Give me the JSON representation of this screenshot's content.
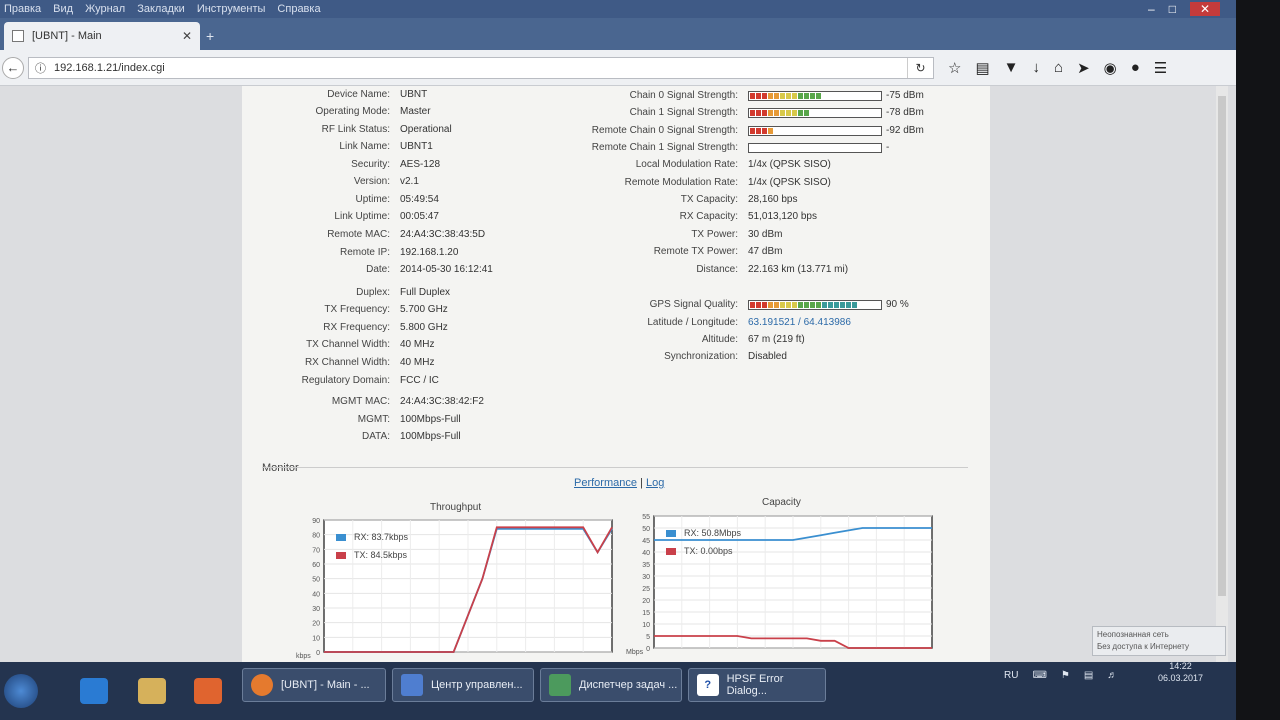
{
  "browser": {
    "menu": [
      "Вид",
      "Правка",
      "Вид",
      "Журнал",
      "Закладки",
      "Инструменты",
      "Справка"
    ],
    "tab_title": "[UBNT] - Main",
    "url": "192.168.1.21/index.cgi"
  },
  "left_fields": [
    {
      "label": "Device Name:",
      "value": "UBNT"
    },
    {
      "label": "Operating Mode:",
      "value": "Master"
    },
    {
      "label": "RF Link Status:",
      "value": "Operational"
    },
    {
      "label": "Link Name:",
      "value": "UBNT1"
    },
    {
      "label": "Security:",
      "value": "AES-128"
    },
    {
      "label": "Version:",
      "value": "v2.1"
    },
    {
      "label": "Uptime:",
      "value": "05:49:54"
    },
    {
      "label": "Link Uptime:",
      "value": "00:05:47"
    },
    {
      "label": "Remote MAC:",
      "value": "24:A4:3C:38:43:5D"
    },
    {
      "label": "Remote IP:",
      "value": "192.168.1.20"
    },
    {
      "label": "Date:",
      "value": "2014-05-30 16:12:41"
    },
    {
      "label": "Duplex:",
      "value": "Full Duplex"
    },
    {
      "label": "TX Frequency:",
      "value": "5.700 GHz"
    },
    {
      "label": "RX Frequency:",
      "value": "5.800 GHz"
    },
    {
      "label": "TX Channel Width:",
      "value": "40 MHz"
    },
    {
      "label": "RX Channel Width:",
      "value": "40 MHz"
    },
    {
      "label": "Regulatory Domain:",
      "value": "FCC / IC"
    },
    {
      "label": "MGMT MAC:",
      "value": "24:A4:3C:38:42:F2"
    },
    {
      "label": "MGMT:",
      "value": "100Mbps-Full"
    },
    {
      "label": "DATA:",
      "value": "100Mbps-Full"
    }
  ],
  "signal": [
    {
      "label": "Chain 0 Signal Strength:",
      "value": "-75 dBm",
      "level": 0.6
    },
    {
      "label": "Chain 1 Signal Strength:",
      "value": "-78 dBm",
      "level": 0.52
    },
    {
      "label": "Remote Chain 0 Signal Strength:",
      "value": "-92 dBm",
      "level": 0.2
    },
    {
      "label": "Remote Chain 1 Signal Strength:",
      "value": "-",
      "level": 0
    }
  ],
  "right_fields": [
    {
      "label": "Local Modulation Rate:",
      "value": "1/4x (QPSK SISO)"
    },
    {
      "label": "Remote Modulation Rate:",
      "value": "1/4x (QPSK SISO)"
    },
    {
      "label": "TX Capacity:",
      "value": "28,160 bps"
    },
    {
      "label": "RX Capacity:",
      "value": "51,013,120 bps"
    },
    {
      "label": "TX Power:",
      "value": "30 dBm"
    },
    {
      "label": "Remote TX Power:",
      "value": "47 dBm"
    },
    {
      "label": "Distance:",
      "value": "22.163 km (13.771 mi)"
    }
  ],
  "gps": {
    "quality_label": "GPS Signal Quality:",
    "quality_value": "90 %",
    "quality_level": 0.9,
    "fields": [
      {
        "label": "Latitude / Longitude:",
        "value": "63.191521 / 64.413986",
        "link": true
      },
      {
        "label": "Altitude:",
        "value": "67 m (219 ft)",
        "link": false
      },
      {
        "label": "Synchronization:",
        "value": "Disabled",
        "link": false
      }
    ]
  },
  "monitor": {
    "title": "Monitor",
    "link_performance": "Performance",
    "separator": "|",
    "link_log": "Log"
  },
  "chart_data": [
    {
      "type": "line",
      "title": "Throughput",
      "ylabel": "kbps",
      "ylim": [
        0,
        90
      ],
      "yticks": [
        0,
        10,
        20,
        30,
        40,
        50,
        60,
        70,
        80,
        90
      ],
      "x": [
        0,
        1,
        2,
        3,
        4,
        5,
        6,
        7,
        8,
        9,
        10,
        11,
        12,
        13,
        14,
        15,
        16,
        17,
        18,
        19,
        20
      ],
      "series": [
        {
          "name": "RX: 83.7kbps",
          "color": "#3a8fd0",
          "values": [
            0,
            0,
            0,
            0,
            0,
            0,
            0,
            0,
            0,
            0,
            25,
            50,
            84,
            84,
            84,
            84,
            84,
            84,
            84,
            68,
            84
          ]
        },
        {
          "name": "TX: 84.5kbps",
          "color": "#c9404a",
          "values": [
            0,
            0,
            0,
            0,
            0,
            0,
            0,
            0,
            0,
            0,
            25,
            50,
            85,
            85,
            85,
            85,
            85,
            85,
            85,
            68,
            85
          ]
        }
      ]
    },
    {
      "type": "line",
      "title": "Capacity",
      "ylabel": "Mbps",
      "ylim": [
        0,
        55
      ],
      "yticks": [
        0,
        5,
        10,
        15,
        20,
        25,
        30,
        35,
        40,
        45,
        50,
        55
      ],
      "x": [
        0,
        1,
        2,
        3,
        4,
        5,
        6,
        7,
        8,
        9,
        10,
        11,
        12,
        13,
        14,
        15,
        16,
        17,
        18,
        19,
        20
      ],
      "series": [
        {
          "name": "RX: 50.8Mbps",
          "color": "#3a8fd0",
          "values": [
            45,
            45,
            45,
            45,
            45,
            45,
            45,
            45,
            45,
            45,
            45,
            46,
            47,
            48,
            49,
            50,
            50,
            50,
            50,
            50,
            50
          ]
        },
        {
          "name": "TX: 0.00bps",
          "color": "#c9404a",
          "values": [
            5,
            5,
            5,
            5,
            5,
            5,
            5,
            4,
            4,
            4,
            4,
            4,
            3,
            3,
            0,
            0,
            0,
            0,
            0,
            0,
            0
          ]
        }
      ]
    }
  ],
  "taskbar": {
    "tasks": [
      "[UBNT] - Main - ...",
      "Центр управлен...",
      "Диспетчер задач ...",
      "HPSF Error Dialog..."
    ],
    "lang": "RU",
    "time": "14:22",
    "date": "06.03.2017",
    "notify_line1": "Неопознанная сеть",
    "notify_line2": "Без доступа к Интернету"
  },
  "colors": {
    "meter_red": "#d23a2e",
    "meter_orange": "#e79a36",
    "meter_yellow": "#d8c94a",
    "meter_green": "#59a64a",
    "meter_teal": "#3a9a9a"
  }
}
